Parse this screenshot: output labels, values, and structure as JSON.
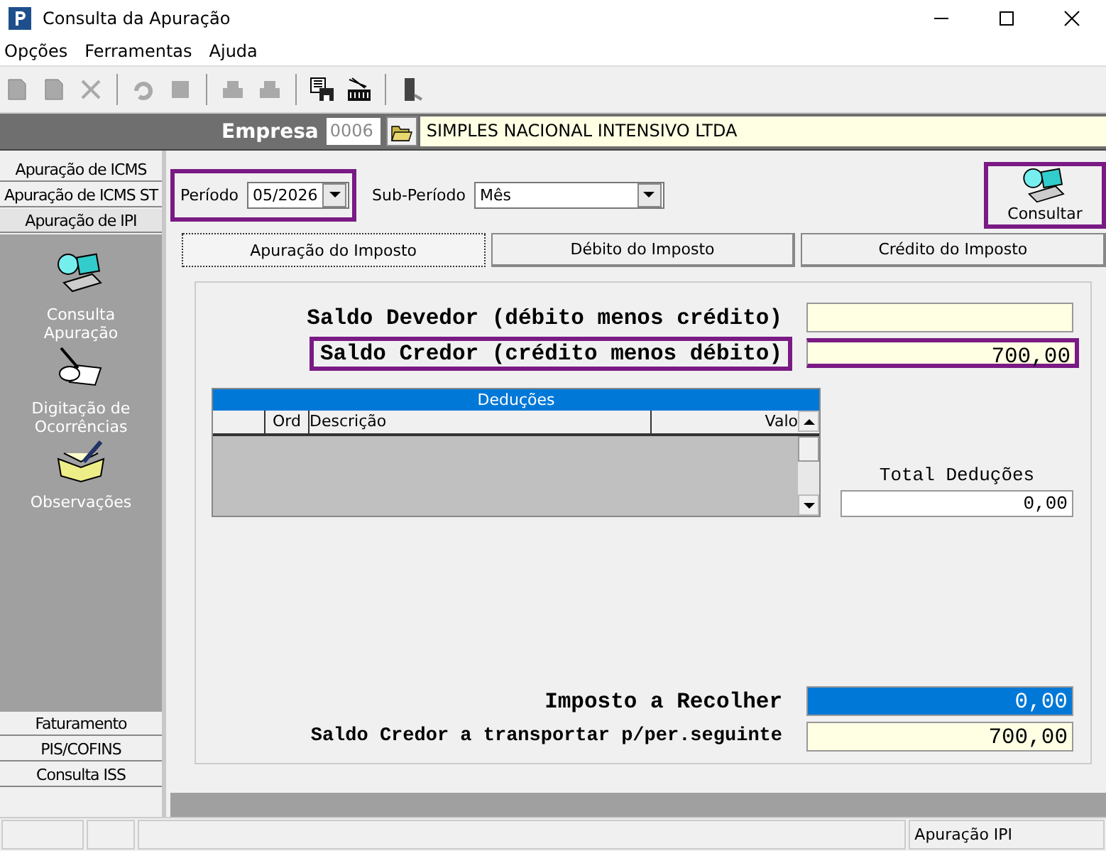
{
  "window": {
    "title": "Consulta da Apuração"
  },
  "menu": [
    "Opções",
    "Ferramentas",
    "Ajuda"
  ],
  "toolbar": [
    {
      "kind": "new",
      "disabled": true
    },
    {
      "kind": "edit",
      "disabled": true
    },
    {
      "kind": "delete",
      "disabled": true
    },
    {
      "kind": "undo",
      "disabled": true
    },
    {
      "kind": "stop",
      "disabled": true
    },
    {
      "kind": "print",
      "disabled": true
    },
    {
      "kind": "print2",
      "disabled": true
    },
    {
      "kind": "save",
      "disabled": false
    },
    {
      "kind": "report",
      "disabled": false
    },
    {
      "kind": "exit",
      "disabled": false
    }
  ],
  "empresa": {
    "label": "Empresa",
    "code": "0006",
    "name": "SIMPLES NACIONAL INTENSIVO LTDA"
  },
  "sidebar": {
    "top_items": [
      {
        "label": "Apuração de ICMS",
        "selected": false
      },
      {
        "label": "Apuração de ICMS ST",
        "selected": false
      },
      {
        "label": "Apuração de IPI",
        "selected": true
      }
    ],
    "actions": [
      {
        "kind": "consult",
        "label": "Consulta Apuração"
      },
      {
        "kind": "typing",
        "label": "Digitação de Ocorrências"
      },
      {
        "kind": "notes",
        "label": "Observações"
      }
    ],
    "bottom_items": [
      "Faturamento",
      "PIS/COFINS",
      "Consulta ISS"
    ]
  },
  "filters": {
    "period": {
      "label": "Período",
      "value": "05/2026",
      "highlighted": true
    },
    "sub_period": {
      "label": "Sub-Período",
      "value": "Mês"
    }
  },
  "consult_button": {
    "label": "Consultar",
    "highlighted": true
  },
  "tabs": [
    {
      "label": "Apuração do Imposto",
      "selected": true
    },
    {
      "label": "Débito do Imposto",
      "selected": false
    },
    {
      "label": "Crédito do Imposto",
      "selected": false
    }
  ],
  "balances": [
    {
      "label": "Saldo Devedor (débito menos crédito)",
      "highlighted": false
    },
    {
      "label": "Saldo Credor (crédito menos débito)",
      "value": "700,00",
      "highlighted": true
    }
  ],
  "deductions": {
    "title": "Deduções",
    "columns": [
      "Ord",
      "Descrição",
      "Valo"
    ],
    "total_label": "Total Deduções",
    "total": "0,00"
  },
  "results": [
    {
      "label": "Imposto a Recolher",
      "value": "0,00",
      "kind": "selected"
    },
    {
      "label": "Saldo Credor a transportar p/per.seguinte",
      "value": "700,00",
      "kind": "plain"
    }
  ],
  "status_bar": {
    "text": "Apuração IPI"
  }
}
